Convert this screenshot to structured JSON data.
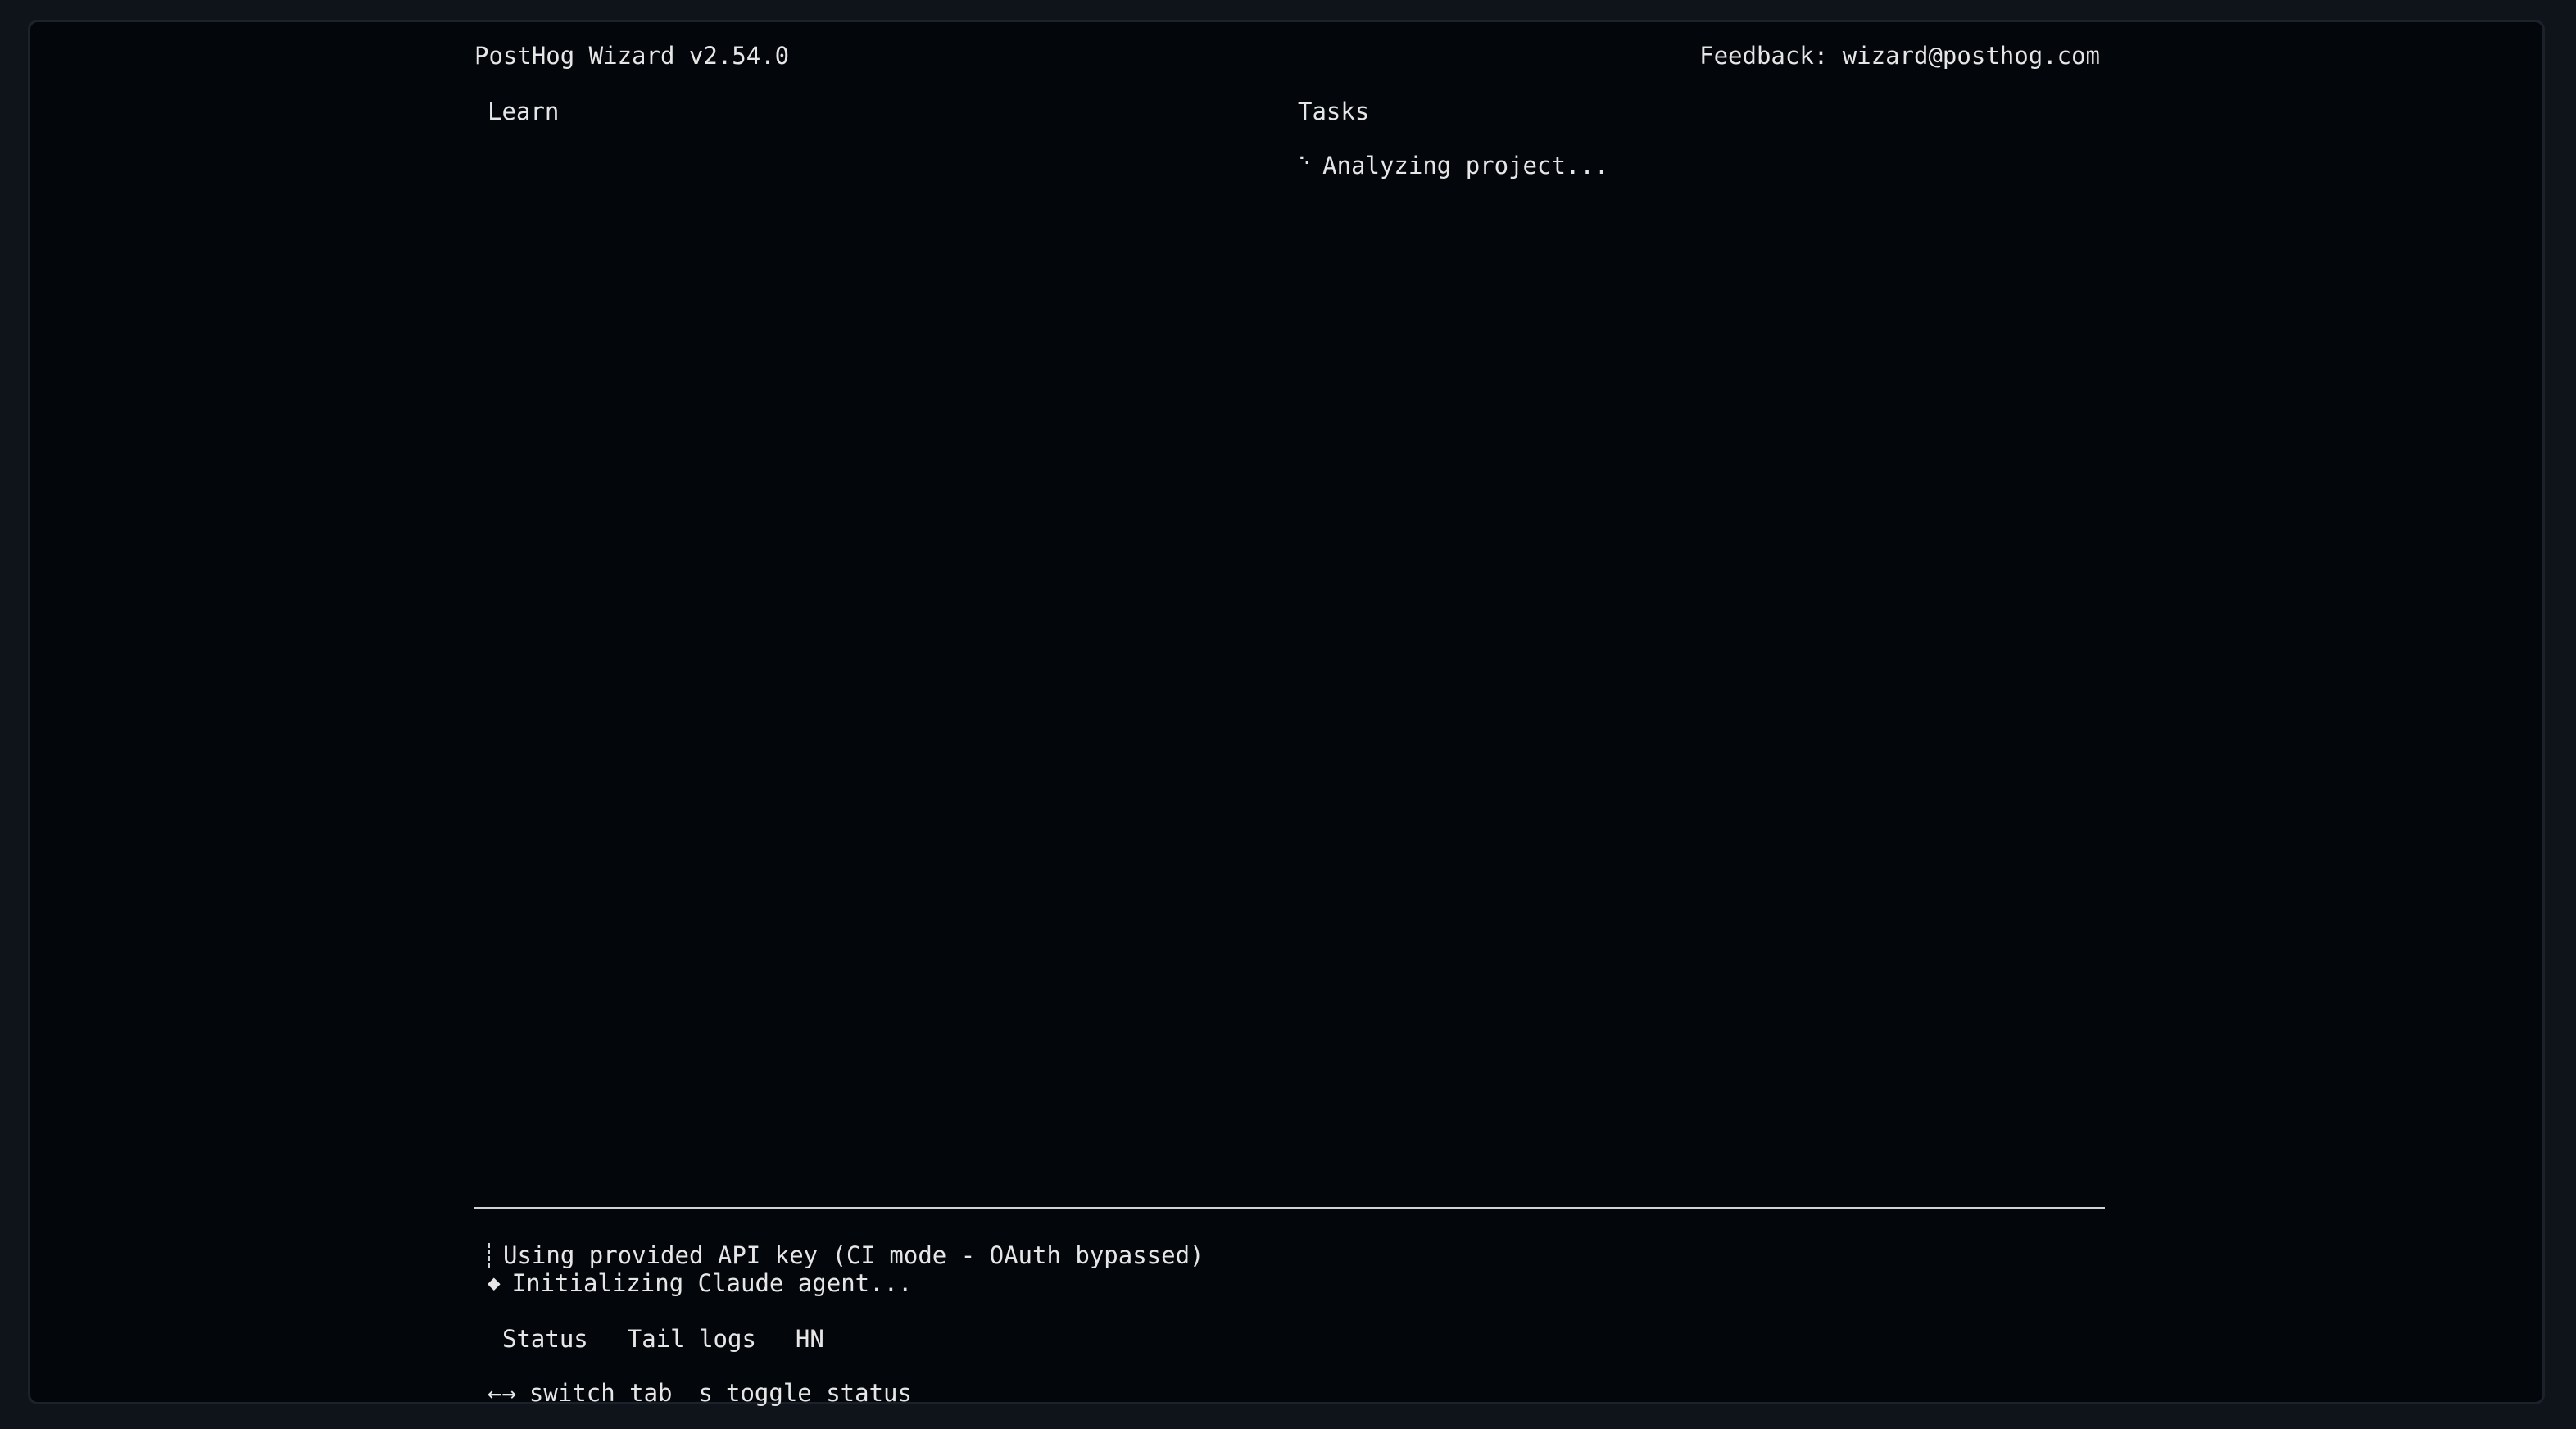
{
  "header": {
    "title": "PostHog Wizard v2.54.0",
    "feedback": "Feedback: wizard@posthog.com"
  },
  "panels": {
    "learn": {
      "title": "Learn"
    },
    "tasks": {
      "title": "Tasks",
      "items": [
        {
          "icon": "spinner-icon",
          "glyph": "⠑",
          "label": "Analyzing project..."
        }
      ]
    }
  },
  "logs": [
    {
      "icon": "bar-icon",
      "text": "Using provided API key (CI mode - OAuth bypassed)"
    },
    {
      "icon": "diamond-icon",
      "glyph": "◆",
      "text": "Initializing Claude agent..."
    }
  ],
  "tabs": [
    "Status",
    "Tail logs",
    "HN"
  ],
  "hints": [
    {
      "key": "←→",
      "action": "switch tab"
    },
    {
      "key": "s",
      "action": "toggle status"
    }
  ],
  "colors": {
    "background": "#03060b",
    "frame": "#0f131a",
    "text": "#e6e6e6",
    "divider": "#cfd3d8"
  }
}
